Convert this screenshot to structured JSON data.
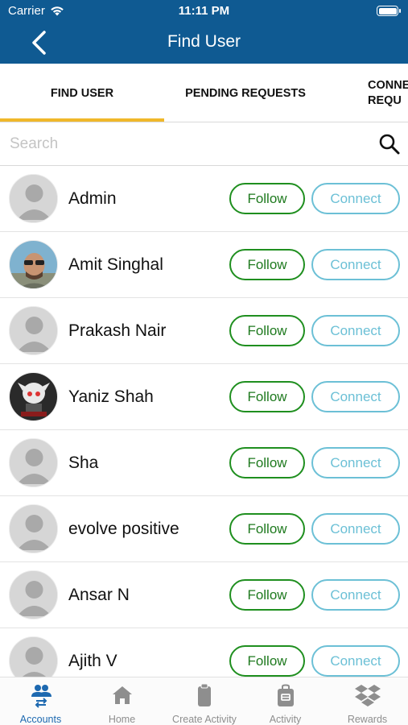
{
  "status_bar": {
    "carrier": "Carrier",
    "time": "11:11 PM"
  },
  "header": {
    "title": "Find User"
  },
  "tabs": [
    {
      "label": "FIND USER",
      "active": true
    },
    {
      "label": "PENDING REQUESTS",
      "active": false
    },
    {
      "label": "CONNE\nREQU",
      "active": false
    }
  ],
  "search": {
    "placeholder": "Search",
    "value": ""
  },
  "users": [
    {
      "name": "Admin",
      "avatar": "default-avatar",
      "follow_label": "Follow",
      "connect_label": "Connect"
    },
    {
      "name": "Amit Singhal",
      "avatar": "photo-avatar",
      "follow_label": "Follow",
      "connect_label": "Connect"
    },
    {
      "name": "Prakash Nair",
      "avatar": "default-avatar",
      "follow_label": "Follow",
      "connect_label": "Connect"
    },
    {
      "name": "Yaniz Shah",
      "avatar": "cartoon-avatar",
      "follow_label": "Follow",
      "connect_label": "Connect"
    },
    {
      "name": "Sha",
      "avatar": "default-avatar",
      "follow_label": "Follow",
      "connect_label": "Connect"
    },
    {
      "name": "evolve positive",
      "avatar": "default-avatar",
      "follow_label": "Follow",
      "connect_label": "Connect"
    },
    {
      "name": "Ansar N",
      "avatar": "default-avatar",
      "follow_label": "Follow",
      "connect_label": "Connect"
    },
    {
      "name": "Ajith V",
      "avatar": "default-avatar",
      "follow_label": "Follow",
      "connect_label": "Connect"
    }
  ],
  "bottom_nav": [
    {
      "label": "Accounts",
      "icon": "accounts-icon",
      "active": true
    },
    {
      "label": "Home",
      "icon": "home-icon",
      "active": false
    },
    {
      "label": "Create Activity",
      "icon": "clipboard-icon",
      "active": false
    },
    {
      "label": "Activity",
      "icon": "bag-icon",
      "active": false
    },
    {
      "label": "Rewards",
      "icon": "dropbox-icon",
      "active": false
    }
  ],
  "colors": {
    "header_bg": "#0f5a92",
    "tab_underline": "#f0b82a",
    "follow": "#1f8f1f",
    "connect": "#6cc0d6",
    "nav_active": "#1d69b0"
  }
}
